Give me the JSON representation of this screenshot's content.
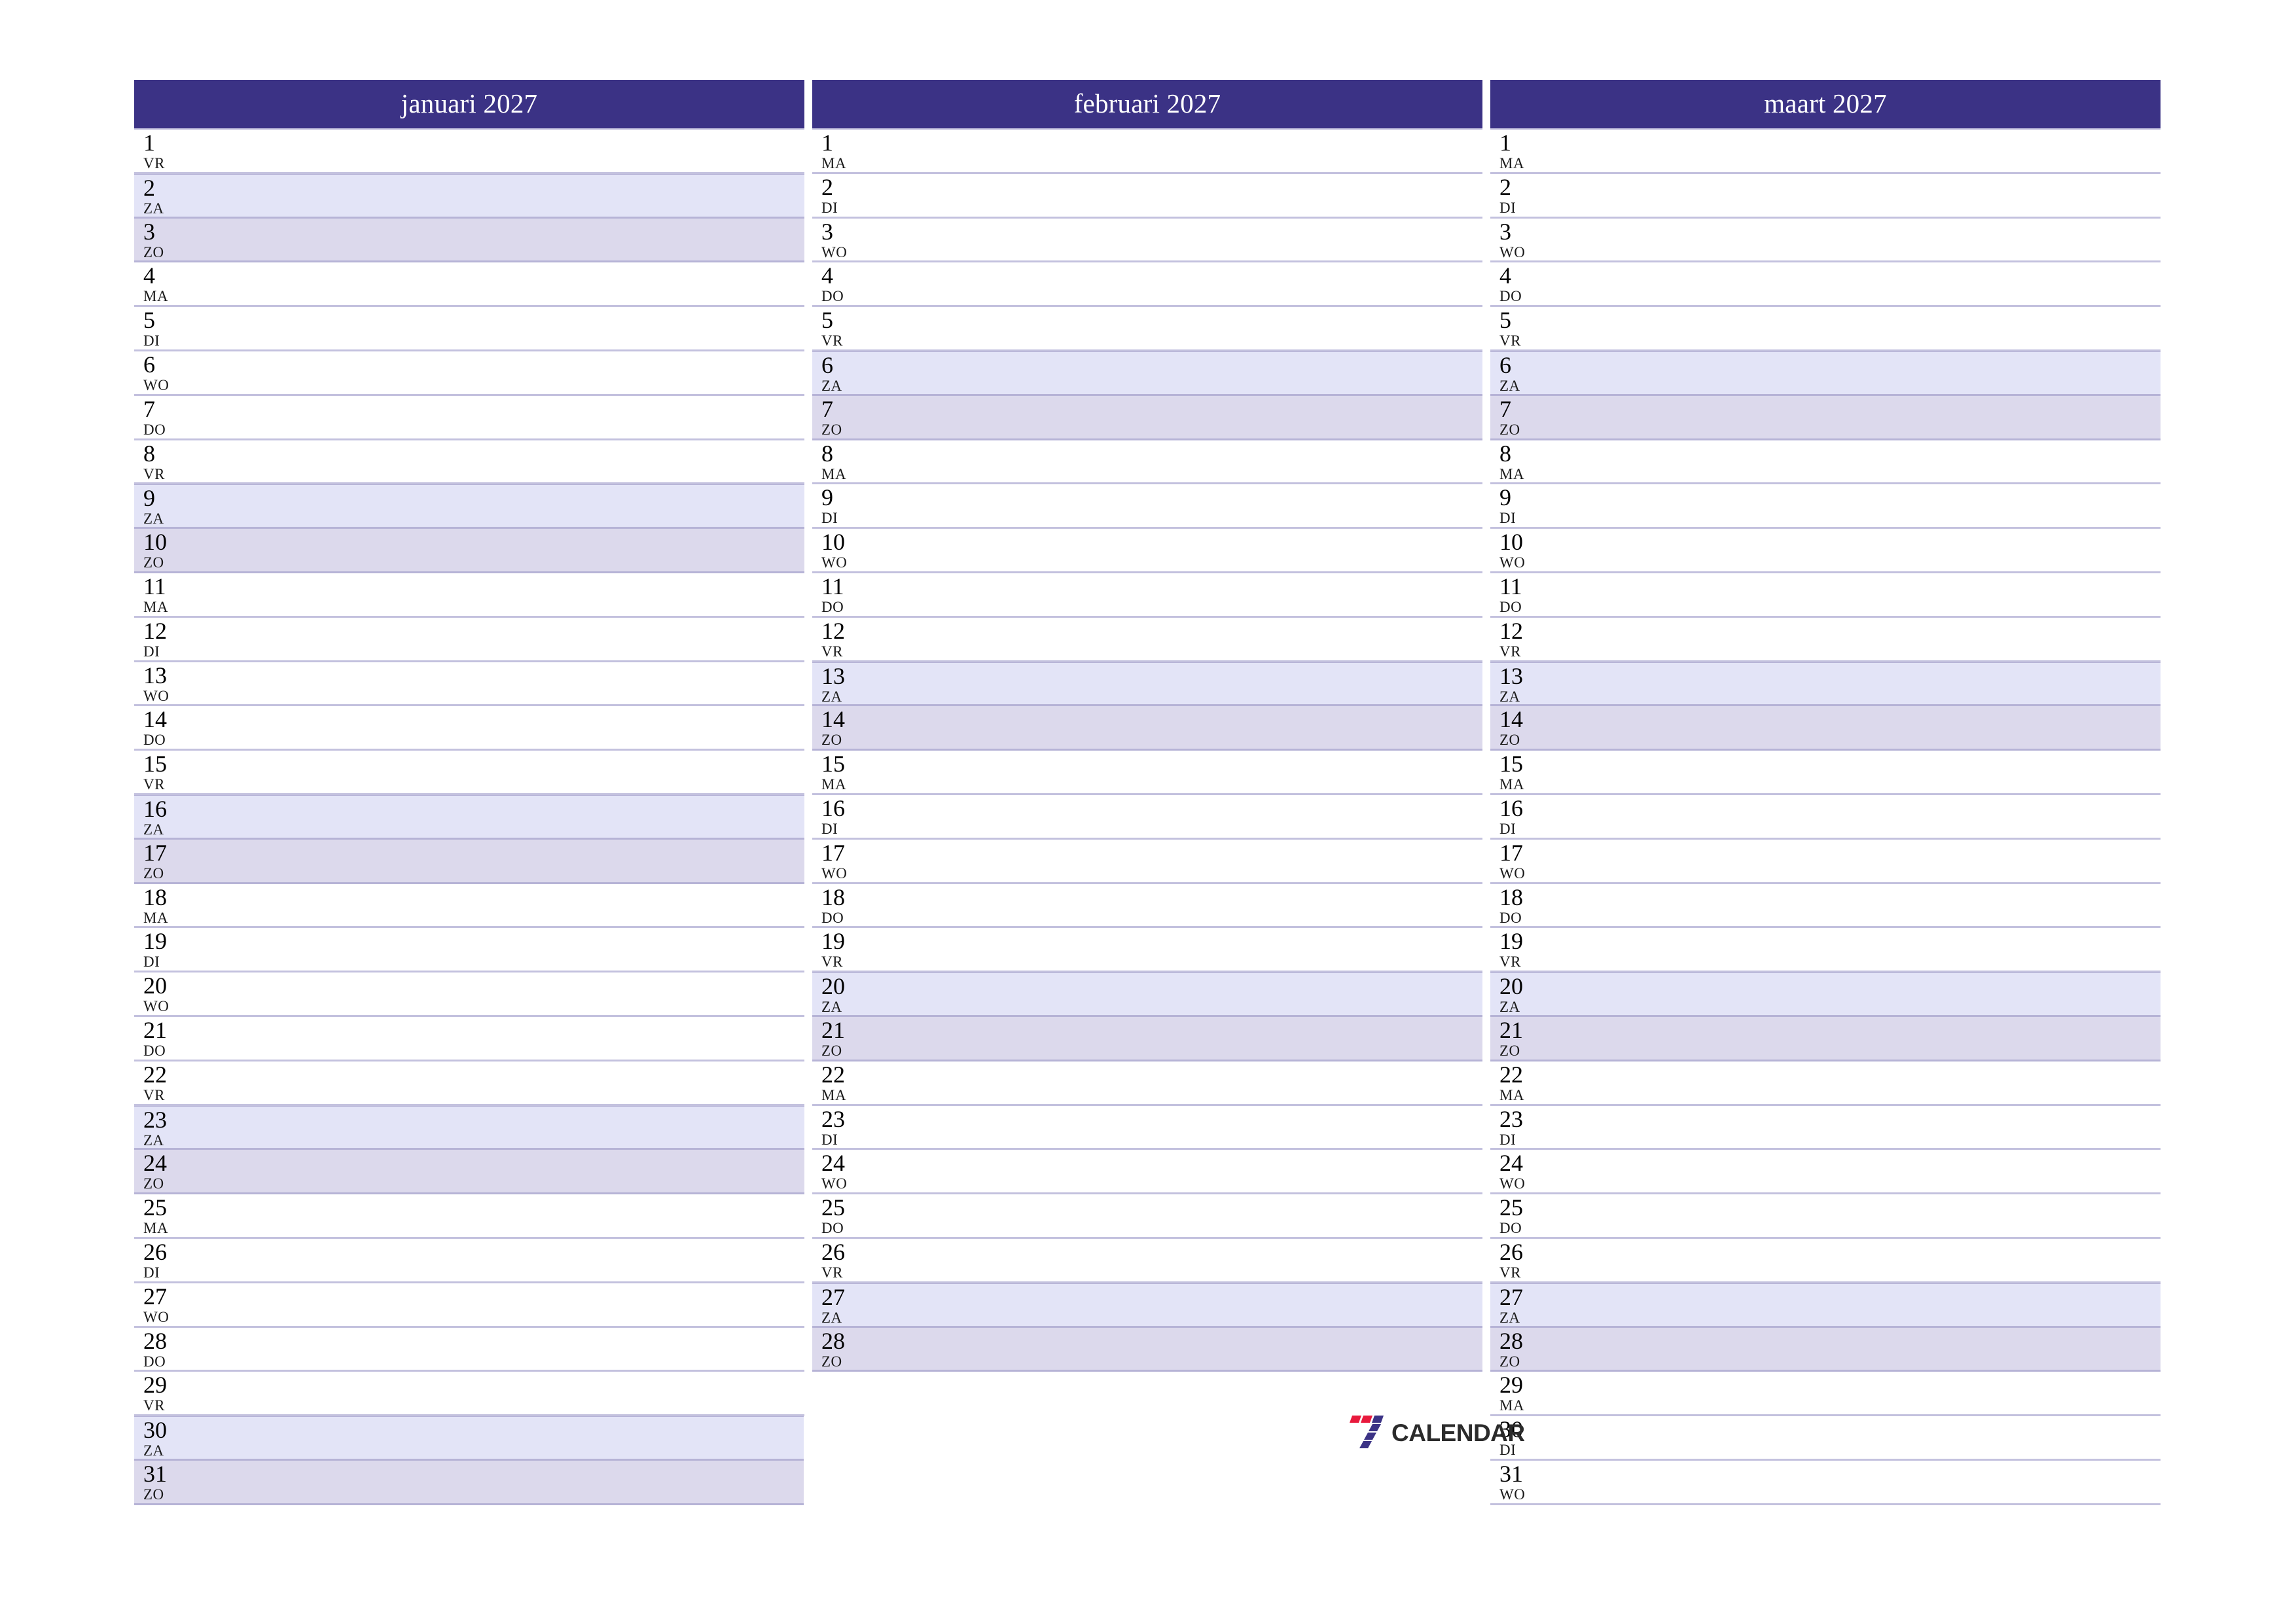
{
  "document": {
    "type": "quarterly-planner",
    "year": "2027",
    "locale": "nl"
  },
  "colors": {
    "header_bg": "#3b3285",
    "header_text": "#ffffff",
    "saturday_bg": "#e3e4f7",
    "sunday_bg": "#dcd9ec",
    "row_divider": "#c3c1de",
    "weekend_divider": "#b6b3d6",
    "logo_red": "#e8193c",
    "logo_blue": "#3b3285",
    "logo_text": "#2b2b2b"
  },
  "logo": {
    "mark": "seven-stripes-icon",
    "wordmark": "CALENDAR"
  },
  "months": [
    {
      "name": "januari 2027",
      "key": "januari",
      "days": [
        {
          "num": "1",
          "weekday": "VR",
          "kind": "weekday"
        },
        {
          "num": "2",
          "weekday": "ZA",
          "kind": "sat"
        },
        {
          "num": "3",
          "weekday": "ZO",
          "kind": "sun"
        },
        {
          "num": "4",
          "weekday": "MA",
          "kind": "weekday"
        },
        {
          "num": "5",
          "weekday": "DI",
          "kind": "weekday"
        },
        {
          "num": "6",
          "weekday": "WO",
          "kind": "weekday"
        },
        {
          "num": "7",
          "weekday": "DO",
          "kind": "weekday"
        },
        {
          "num": "8",
          "weekday": "VR",
          "kind": "weekday"
        },
        {
          "num": "9",
          "weekday": "ZA",
          "kind": "sat"
        },
        {
          "num": "10",
          "weekday": "ZO",
          "kind": "sun"
        },
        {
          "num": "11",
          "weekday": "MA",
          "kind": "weekday"
        },
        {
          "num": "12",
          "weekday": "DI",
          "kind": "weekday"
        },
        {
          "num": "13",
          "weekday": "WO",
          "kind": "weekday"
        },
        {
          "num": "14",
          "weekday": "DO",
          "kind": "weekday"
        },
        {
          "num": "15",
          "weekday": "VR",
          "kind": "weekday"
        },
        {
          "num": "16",
          "weekday": "ZA",
          "kind": "sat"
        },
        {
          "num": "17",
          "weekday": "ZO",
          "kind": "sun"
        },
        {
          "num": "18",
          "weekday": "MA",
          "kind": "weekday"
        },
        {
          "num": "19",
          "weekday": "DI",
          "kind": "weekday"
        },
        {
          "num": "20",
          "weekday": "WO",
          "kind": "weekday"
        },
        {
          "num": "21",
          "weekday": "DO",
          "kind": "weekday"
        },
        {
          "num": "22",
          "weekday": "VR",
          "kind": "weekday"
        },
        {
          "num": "23",
          "weekday": "ZA",
          "kind": "sat"
        },
        {
          "num": "24",
          "weekday": "ZO",
          "kind": "sun"
        },
        {
          "num": "25",
          "weekday": "MA",
          "kind": "weekday"
        },
        {
          "num": "26",
          "weekday": "DI",
          "kind": "weekday"
        },
        {
          "num": "27",
          "weekday": "WO",
          "kind": "weekday"
        },
        {
          "num": "28",
          "weekday": "DO",
          "kind": "weekday"
        },
        {
          "num": "29",
          "weekday": "VR",
          "kind": "weekday"
        },
        {
          "num": "30",
          "weekday": "ZA",
          "kind": "sat"
        },
        {
          "num": "31",
          "weekday": "ZO",
          "kind": "sun"
        }
      ]
    },
    {
      "name": "februari 2027",
      "key": "februari",
      "days": [
        {
          "num": "1",
          "weekday": "MA",
          "kind": "weekday"
        },
        {
          "num": "2",
          "weekday": "DI",
          "kind": "weekday"
        },
        {
          "num": "3",
          "weekday": "WO",
          "kind": "weekday"
        },
        {
          "num": "4",
          "weekday": "DO",
          "kind": "weekday"
        },
        {
          "num": "5",
          "weekday": "VR",
          "kind": "weekday"
        },
        {
          "num": "6",
          "weekday": "ZA",
          "kind": "sat"
        },
        {
          "num": "7",
          "weekday": "ZO",
          "kind": "sun"
        },
        {
          "num": "8",
          "weekday": "MA",
          "kind": "weekday"
        },
        {
          "num": "9",
          "weekday": "DI",
          "kind": "weekday"
        },
        {
          "num": "10",
          "weekday": "WO",
          "kind": "weekday"
        },
        {
          "num": "11",
          "weekday": "DO",
          "kind": "weekday"
        },
        {
          "num": "12",
          "weekday": "VR",
          "kind": "weekday"
        },
        {
          "num": "13",
          "weekday": "ZA",
          "kind": "sat"
        },
        {
          "num": "14",
          "weekday": "ZO",
          "kind": "sun"
        },
        {
          "num": "15",
          "weekday": "MA",
          "kind": "weekday"
        },
        {
          "num": "16",
          "weekday": "DI",
          "kind": "weekday"
        },
        {
          "num": "17",
          "weekday": "WO",
          "kind": "weekday"
        },
        {
          "num": "18",
          "weekday": "DO",
          "kind": "weekday"
        },
        {
          "num": "19",
          "weekday": "VR",
          "kind": "weekday"
        },
        {
          "num": "20",
          "weekday": "ZA",
          "kind": "sat"
        },
        {
          "num": "21",
          "weekday": "ZO",
          "kind": "sun"
        },
        {
          "num": "22",
          "weekday": "MA",
          "kind": "weekday"
        },
        {
          "num": "23",
          "weekday": "DI",
          "kind": "weekday"
        },
        {
          "num": "24",
          "weekday": "WO",
          "kind": "weekday"
        },
        {
          "num": "25",
          "weekday": "DO",
          "kind": "weekday"
        },
        {
          "num": "26",
          "weekday": "VR",
          "kind": "weekday"
        },
        {
          "num": "27",
          "weekday": "ZA",
          "kind": "sat"
        },
        {
          "num": "28",
          "weekday": "ZO",
          "kind": "sun"
        }
      ]
    },
    {
      "name": "maart 2027",
      "key": "maart",
      "days": [
        {
          "num": "1",
          "weekday": "MA",
          "kind": "weekday"
        },
        {
          "num": "2",
          "weekday": "DI",
          "kind": "weekday"
        },
        {
          "num": "3",
          "weekday": "WO",
          "kind": "weekday"
        },
        {
          "num": "4",
          "weekday": "DO",
          "kind": "weekday"
        },
        {
          "num": "5",
          "weekday": "VR",
          "kind": "weekday"
        },
        {
          "num": "6",
          "weekday": "ZA",
          "kind": "sat"
        },
        {
          "num": "7",
          "weekday": "ZO",
          "kind": "sun"
        },
        {
          "num": "8",
          "weekday": "MA",
          "kind": "weekday"
        },
        {
          "num": "9",
          "weekday": "DI",
          "kind": "weekday"
        },
        {
          "num": "10",
          "weekday": "WO",
          "kind": "weekday"
        },
        {
          "num": "11",
          "weekday": "DO",
          "kind": "weekday"
        },
        {
          "num": "12",
          "weekday": "VR",
          "kind": "weekday"
        },
        {
          "num": "13",
          "weekday": "ZA",
          "kind": "sat"
        },
        {
          "num": "14",
          "weekday": "ZO",
          "kind": "sun"
        },
        {
          "num": "15",
          "weekday": "MA",
          "kind": "weekday"
        },
        {
          "num": "16",
          "weekday": "DI",
          "kind": "weekday"
        },
        {
          "num": "17",
          "weekday": "WO",
          "kind": "weekday"
        },
        {
          "num": "18",
          "weekday": "DO",
          "kind": "weekday"
        },
        {
          "num": "19",
          "weekday": "VR",
          "kind": "weekday"
        },
        {
          "num": "20",
          "weekday": "ZA",
          "kind": "sat"
        },
        {
          "num": "21",
          "weekday": "ZO",
          "kind": "sun"
        },
        {
          "num": "22",
          "weekday": "MA",
          "kind": "weekday"
        },
        {
          "num": "23",
          "weekday": "DI",
          "kind": "weekday"
        },
        {
          "num": "24",
          "weekday": "WO",
          "kind": "weekday"
        },
        {
          "num": "25",
          "weekday": "DO",
          "kind": "weekday"
        },
        {
          "num": "26",
          "weekday": "VR",
          "kind": "weekday"
        },
        {
          "num": "27",
          "weekday": "ZA",
          "kind": "sat"
        },
        {
          "num": "28",
          "weekday": "ZO",
          "kind": "sun"
        },
        {
          "num": "29",
          "weekday": "MA",
          "kind": "weekday"
        },
        {
          "num": "30",
          "weekday": "DI",
          "kind": "weekday"
        },
        {
          "num": "31",
          "weekday": "WO",
          "kind": "weekday"
        }
      ]
    }
  ]
}
